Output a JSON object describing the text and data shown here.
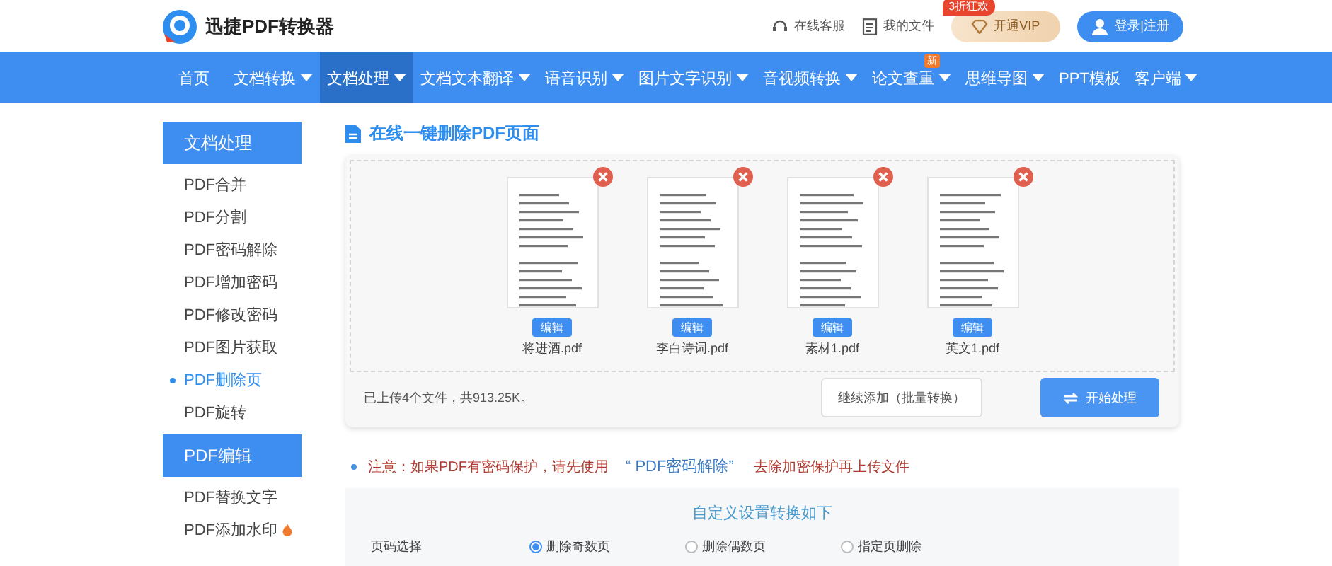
{
  "header": {
    "logo_text": "迅捷PDF转换器",
    "links": [
      "在线客服",
      "我的文件"
    ],
    "vip_button": {
      "label": "开通VIP",
      "badge": "3折狂欢"
    },
    "login_button": "登录|注册"
  },
  "nav": [
    {
      "label": "首页",
      "dropdown": false,
      "selected": false
    },
    {
      "label": "文档转换",
      "dropdown": true,
      "selected": false
    },
    {
      "label": "文档处理",
      "dropdown": true,
      "selected": true
    },
    {
      "label": "文档文本翻译",
      "dropdown": true,
      "selected": false
    },
    {
      "label": "语音识别",
      "dropdown": true,
      "selected": false
    },
    {
      "label": "图片文字识别",
      "dropdown": true,
      "selected": false
    },
    {
      "label": "音视频转换",
      "dropdown": true,
      "selected": false
    },
    {
      "label": "论文查重",
      "dropdown": true,
      "selected": false,
      "badge": "新"
    },
    {
      "label": "思维导图",
      "dropdown": true,
      "selected": false
    },
    {
      "label": "PPT模板",
      "dropdown": false,
      "selected": false
    },
    {
      "label": "客户端",
      "dropdown": true,
      "selected": false
    }
  ],
  "sidebar": [
    {
      "title": "文档处理",
      "items": [
        {
          "label": "PDF合并",
          "selected": false,
          "hot": false
        },
        {
          "label": "PDF分割",
          "selected": false,
          "hot": false
        },
        {
          "label": "PDF密码解除",
          "selected": false,
          "hot": false
        },
        {
          "label": "PDF增加密码",
          "selected": false,
          "hot": false
        },
        {
          "label": "PDF修改密码",
          "selected": false,
          "hot": false
        },
        {
          "label": "PDF图片获取",
          "selected": false,
          "hot": false
        },
        {
          "label": "PDF删除页",
          "selected": true,
          "hot": false
        },
        {
          "label": "PDF旋转",
          "selected": false,
          "hot": false
        }
      ]
    },
    {
      "title": "PDF编辑",
      "items": [
        {
          "label": "PDF替换文字",
          "selected": false,
          "hot": false
        },
        {
          "label": "PDF添加水印",
          "selected": false,
          "hot": true
        }
      ]
    }
  ],
  "main": {
    "title": "在线一键删除PDF页面",
    "files": [
      {
        "name": "将进酒.pdf",
        "edit": "编辑"
      },
      {
        "name": "李白诗词.pdf",
        "edit": "编辑"
      },
      {
        "name": "素材1.pdf",
        "edit": "编辑"
      },
      {
        "name": "英文1.pdf",
        "edit": "编辑"
      }
    ],
    "upload_status": "已上传4个文件，共913.25K。",
    "add_button": "继续添加（批量转换）",
    "start_button": "开始处理",
    "notice": {
      "before": "注意：如果PDF有密码保护，请先使用",
      "link": "“ PDF密码解除”",
      "after": "去除加密保护再上传文件"
    },
    "settings": {
      "title": "自定义设置转换如下",
      "row_label": "页码选择",
      "options": [
        {
          "label": "删除奇数页",
          "selected": true
        },
        {
          "label": "删除偶数页",
          "selected": false
        },
        {
          "label": "指定页删除",
          "selected": false
        }
      ]
    }
  }
}
